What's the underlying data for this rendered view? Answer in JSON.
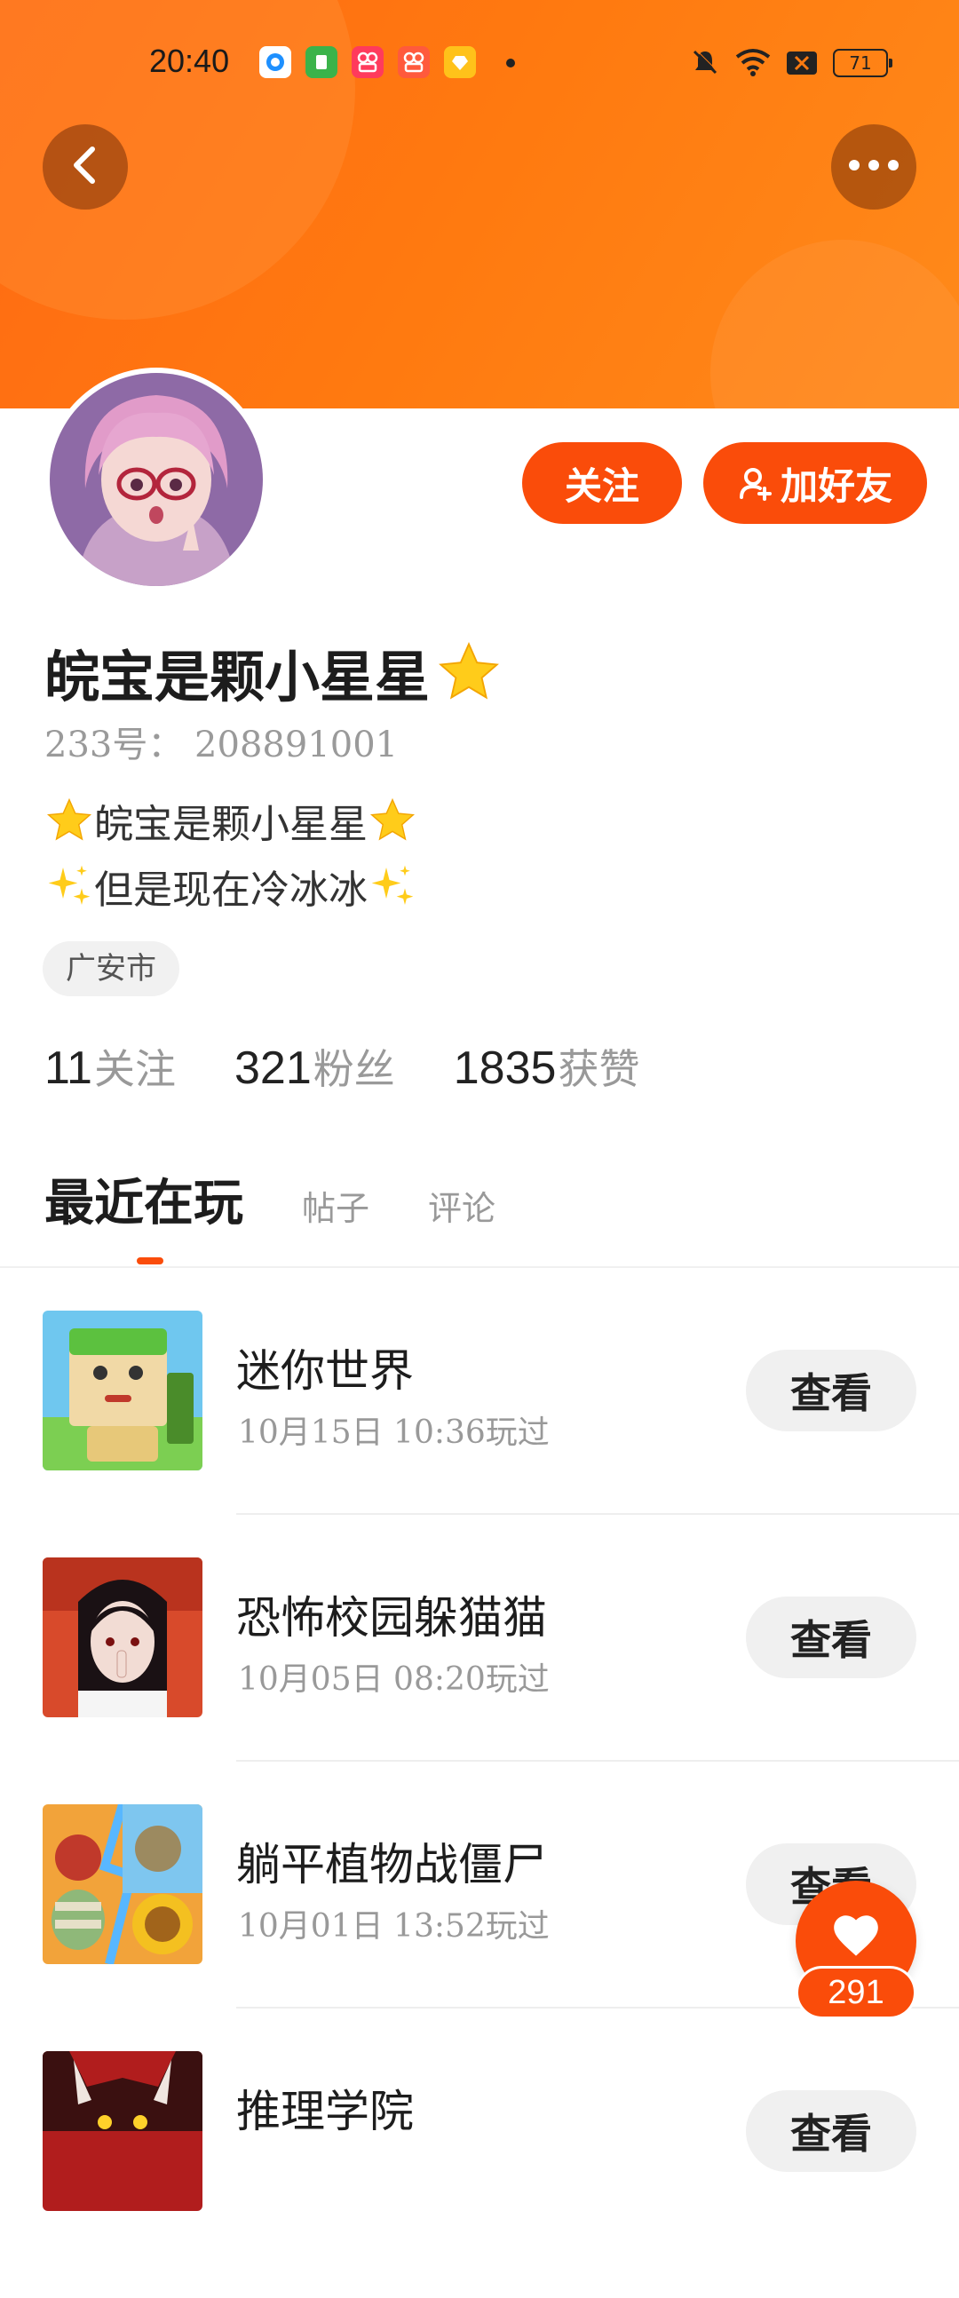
{
  "status_bar": {
    "time": "20:40",
    "battery": "71"
  },
  "header": {
    "back_icon": "chevron-left-icon",
    "more_icon": "more-dots-icon",
    "gradient_colors": [
      "#ff6a13",
      "#ff8a1a"
    ]
  },
  "profile": {
    "nickname": "皖宝是颗小星星",
    "nickname_emoji": "star",
    "user_id": "233号：  208891001",
    "bio_line1": "皖宝是颗小星星",
    "bio_line2": "但是现在冷冰冰",
    "location": "广安市",
    "follow_label": "关注",
    "add_friend_label": "加好友",
    "accent_color": "#fa4c0a"
  },
  "stats": [
    {
      "num": "11",
      "label": "关注"
    },
    {
      "num": "321",
      "label": "粉丝"
    },
    {
      "num": "1835",
      "label": "获赞"
    }
  ],
  "tabs": {
    "active": "最近在玩",
    "items": [
      "帖子",
      "评论"
    ]
  },
  "games": [
    {
      "name": "迷你世界",
      "time": "10月15日  10:36玩过",
      "button": "查看"
    },
    {
      "name": "恐怖校园躲猫猫",
      "time": "10月05日  08:20玩过",
      "button": "查看"
    },
    {
      "name": "躺平植物战僵尸",
      "time": "10月01日  13:52玩过",
      "button": "查看"
    },
    {
      "name": "推理学院",
      "time": "",
      "button": "查看"
    }
  ],
  "like_fab": {
    "count": "291",
    "icon": "heart-icon"
  }
}
